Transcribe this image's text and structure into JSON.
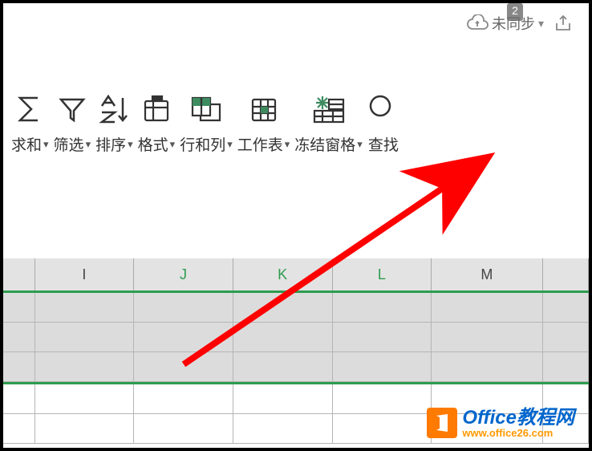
{
  "titlebar": {
    "stack_count": "2",
    "sync_label": "未同步"
  },
  "ribbon": {
    "items": [
      {
        "label": "求和",
        "name": "sum-button"
      },
      {
        "label": "筛选",
        "name": "filter-button"
      },
      {
        "label": "排序",
        "name": "sort-button"
      },
      {
        "label": "格式",
        "name": "format-button"
      },
      {
        "label": "行和列",
        "name": "row-col-button"
      },
      {
        "label": "工作表",
        "name": "worksheet-button"
      },
      {
        "label": "冻结窗格",
        "name": "freeze-panes-button"
      },
      {
        "label": "查找",
        "name": "find-button"
      }
    ]
  },
  "columns": [
    "I",
    "J",
    "K",
    "L",
    "M"
  ],
  "watermark": {
    "title": "Office教程网",
    "url": "www.office26.com"
  }
}
